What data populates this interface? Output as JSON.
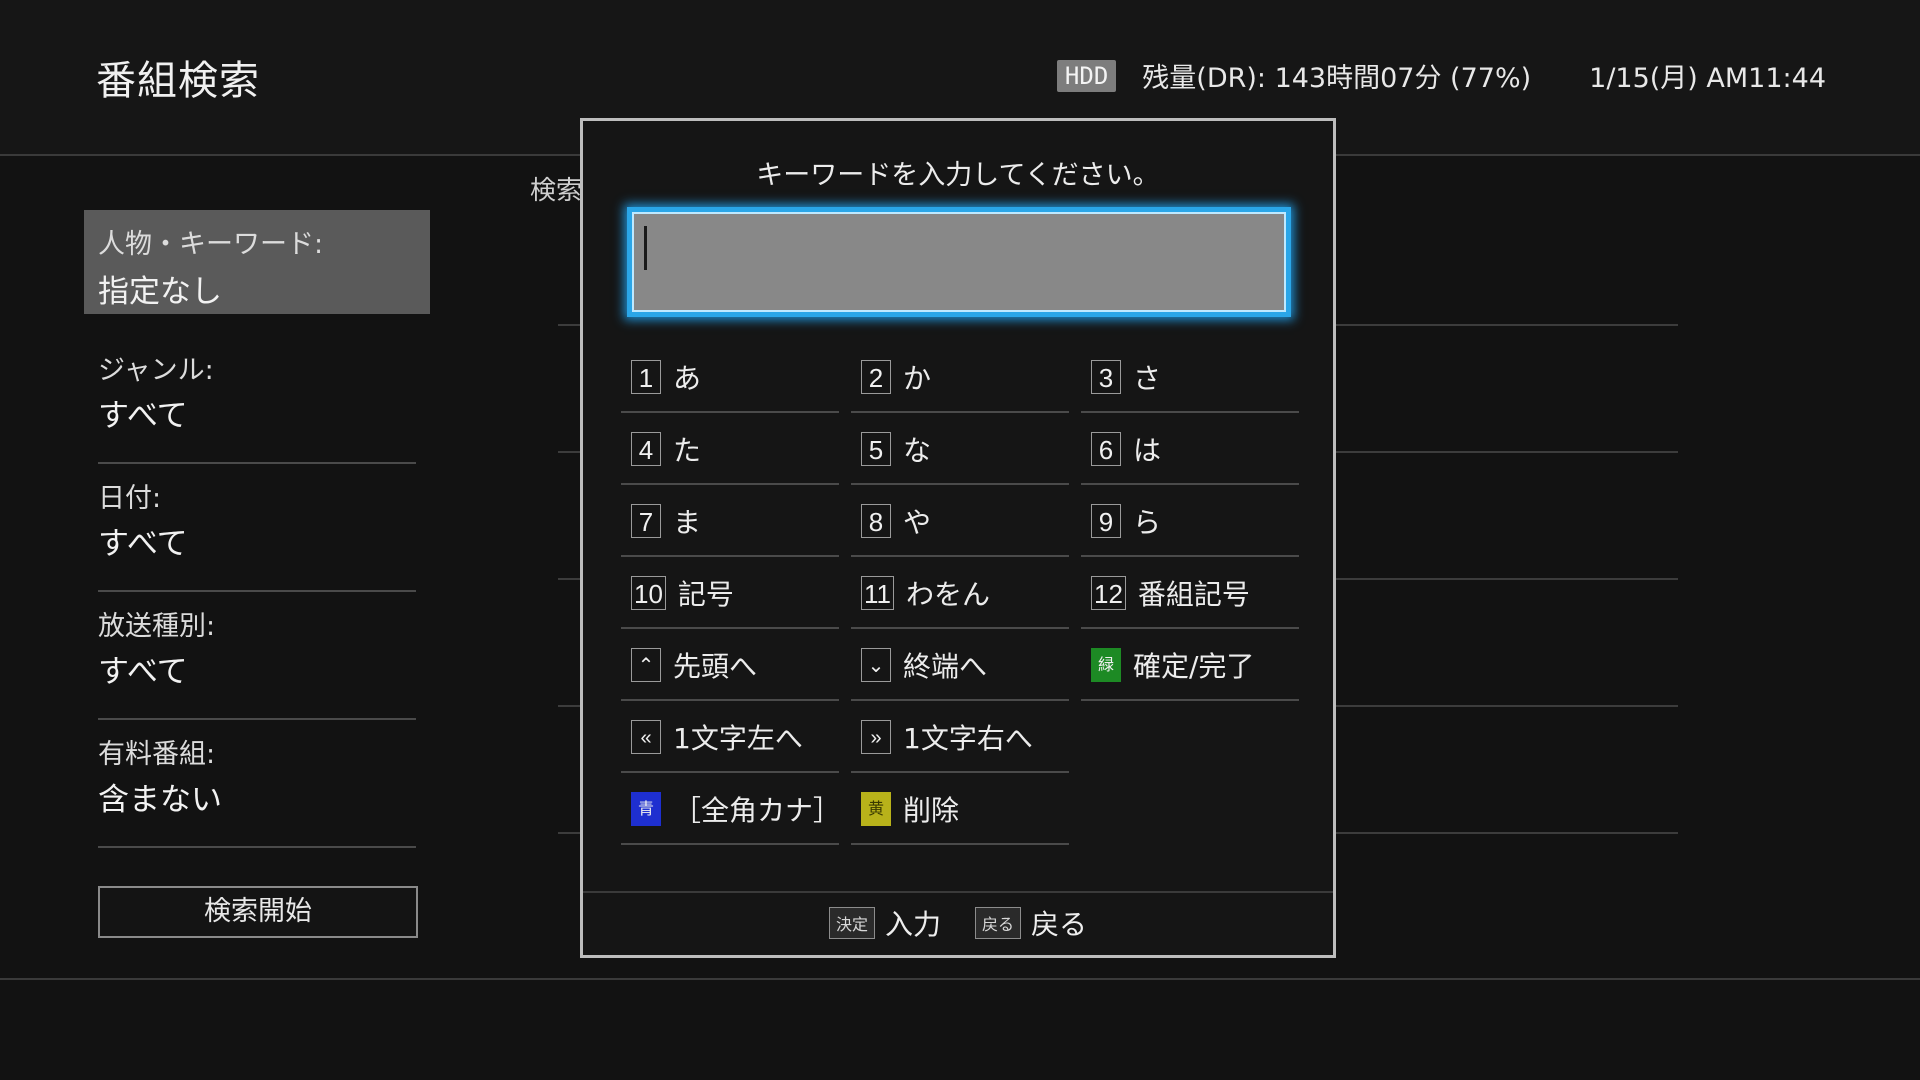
{
  "header": {
    "title": "番組検索",
    "hdd_badge": "HDD",
    "remaining": "残量(DR): 143時間07分 (77%)",
    "datetime": "1/15(月) AM11:44"
  },
  "left_panel": {
    "fields": [
      {
        "label": "人物・キーワード:",
        "value": "指定なし"
      },
      {
        "label": "ジャンル:",
        "value": "すべて"
      },
      {
        "label": "日付:",
        "value": "すべて"
      },
      {
        "label": "放送種別:",
        "value": "すべて"
      },
      {
        "label": "有料番組:",
        "value": "含まない"
      }
    ],
    "search_button": "検索開始"
  },
  "background": {
    "partial_header": "検索"
  },
  "dialog": {
    "prompt": "キーワードを入力してください。",
    "input_value": "",
    "keys": [
      {
        "badge": "1",
        "label": "あ"
      },
      {
        "badge": "2",
        "label": "か"
      },
      {
        "badge": "3",
        "label": "さ"
      },
      {
        "badge": "4",
        "label": "た"
      },
      {
        "badge": "5",
        "label": "な"
      },
      {
        "badge": "6",
        "label": "は"
      },
      {
        "badge": "7",
        "label": "ま"
      },
      {
        "badge": "8",
        "label": "や"
      },
      {
        "badge": "9",
        "label": "ら"
      },
      {
        "badge": "10",
        "label": "記号"
      },
      {
        "badge": "11",
        "label": "わをん"
      },
      {
        "badge": "12",
        "label": "番組記号"
      },
      {
        "badge": "⌃",
        "label": "先頭へ"
      },
      {
        "badge": "⌄",
        "label": "終端へ"
      },
      {
        "badge": "緑",
        "label": "確定/完了"
      },
      {
        "badge": "«",
        "label": "1文字左へ"
      },
      {
        "badge": "»",
        "label": "1文字右へ"
      },
      {
        "badge": "青",
        "label": "［全角カナ］"
      },
      {
        "badge": "黄",
        "label": "削除"
      }
    ],
    "footer": {
      "enter_key": "決定",
      "enter_label": "入力",
      "back_key": "戻る",
      "back_label": "戻る"
    }
  },
  "colors": {
    "input_focus": "#2aa6e8",
    "green_button": "#1d8a24",
    "blue_button": "#1e2fd0",
    "yellow_button": "#b8b21a"
  }
}
